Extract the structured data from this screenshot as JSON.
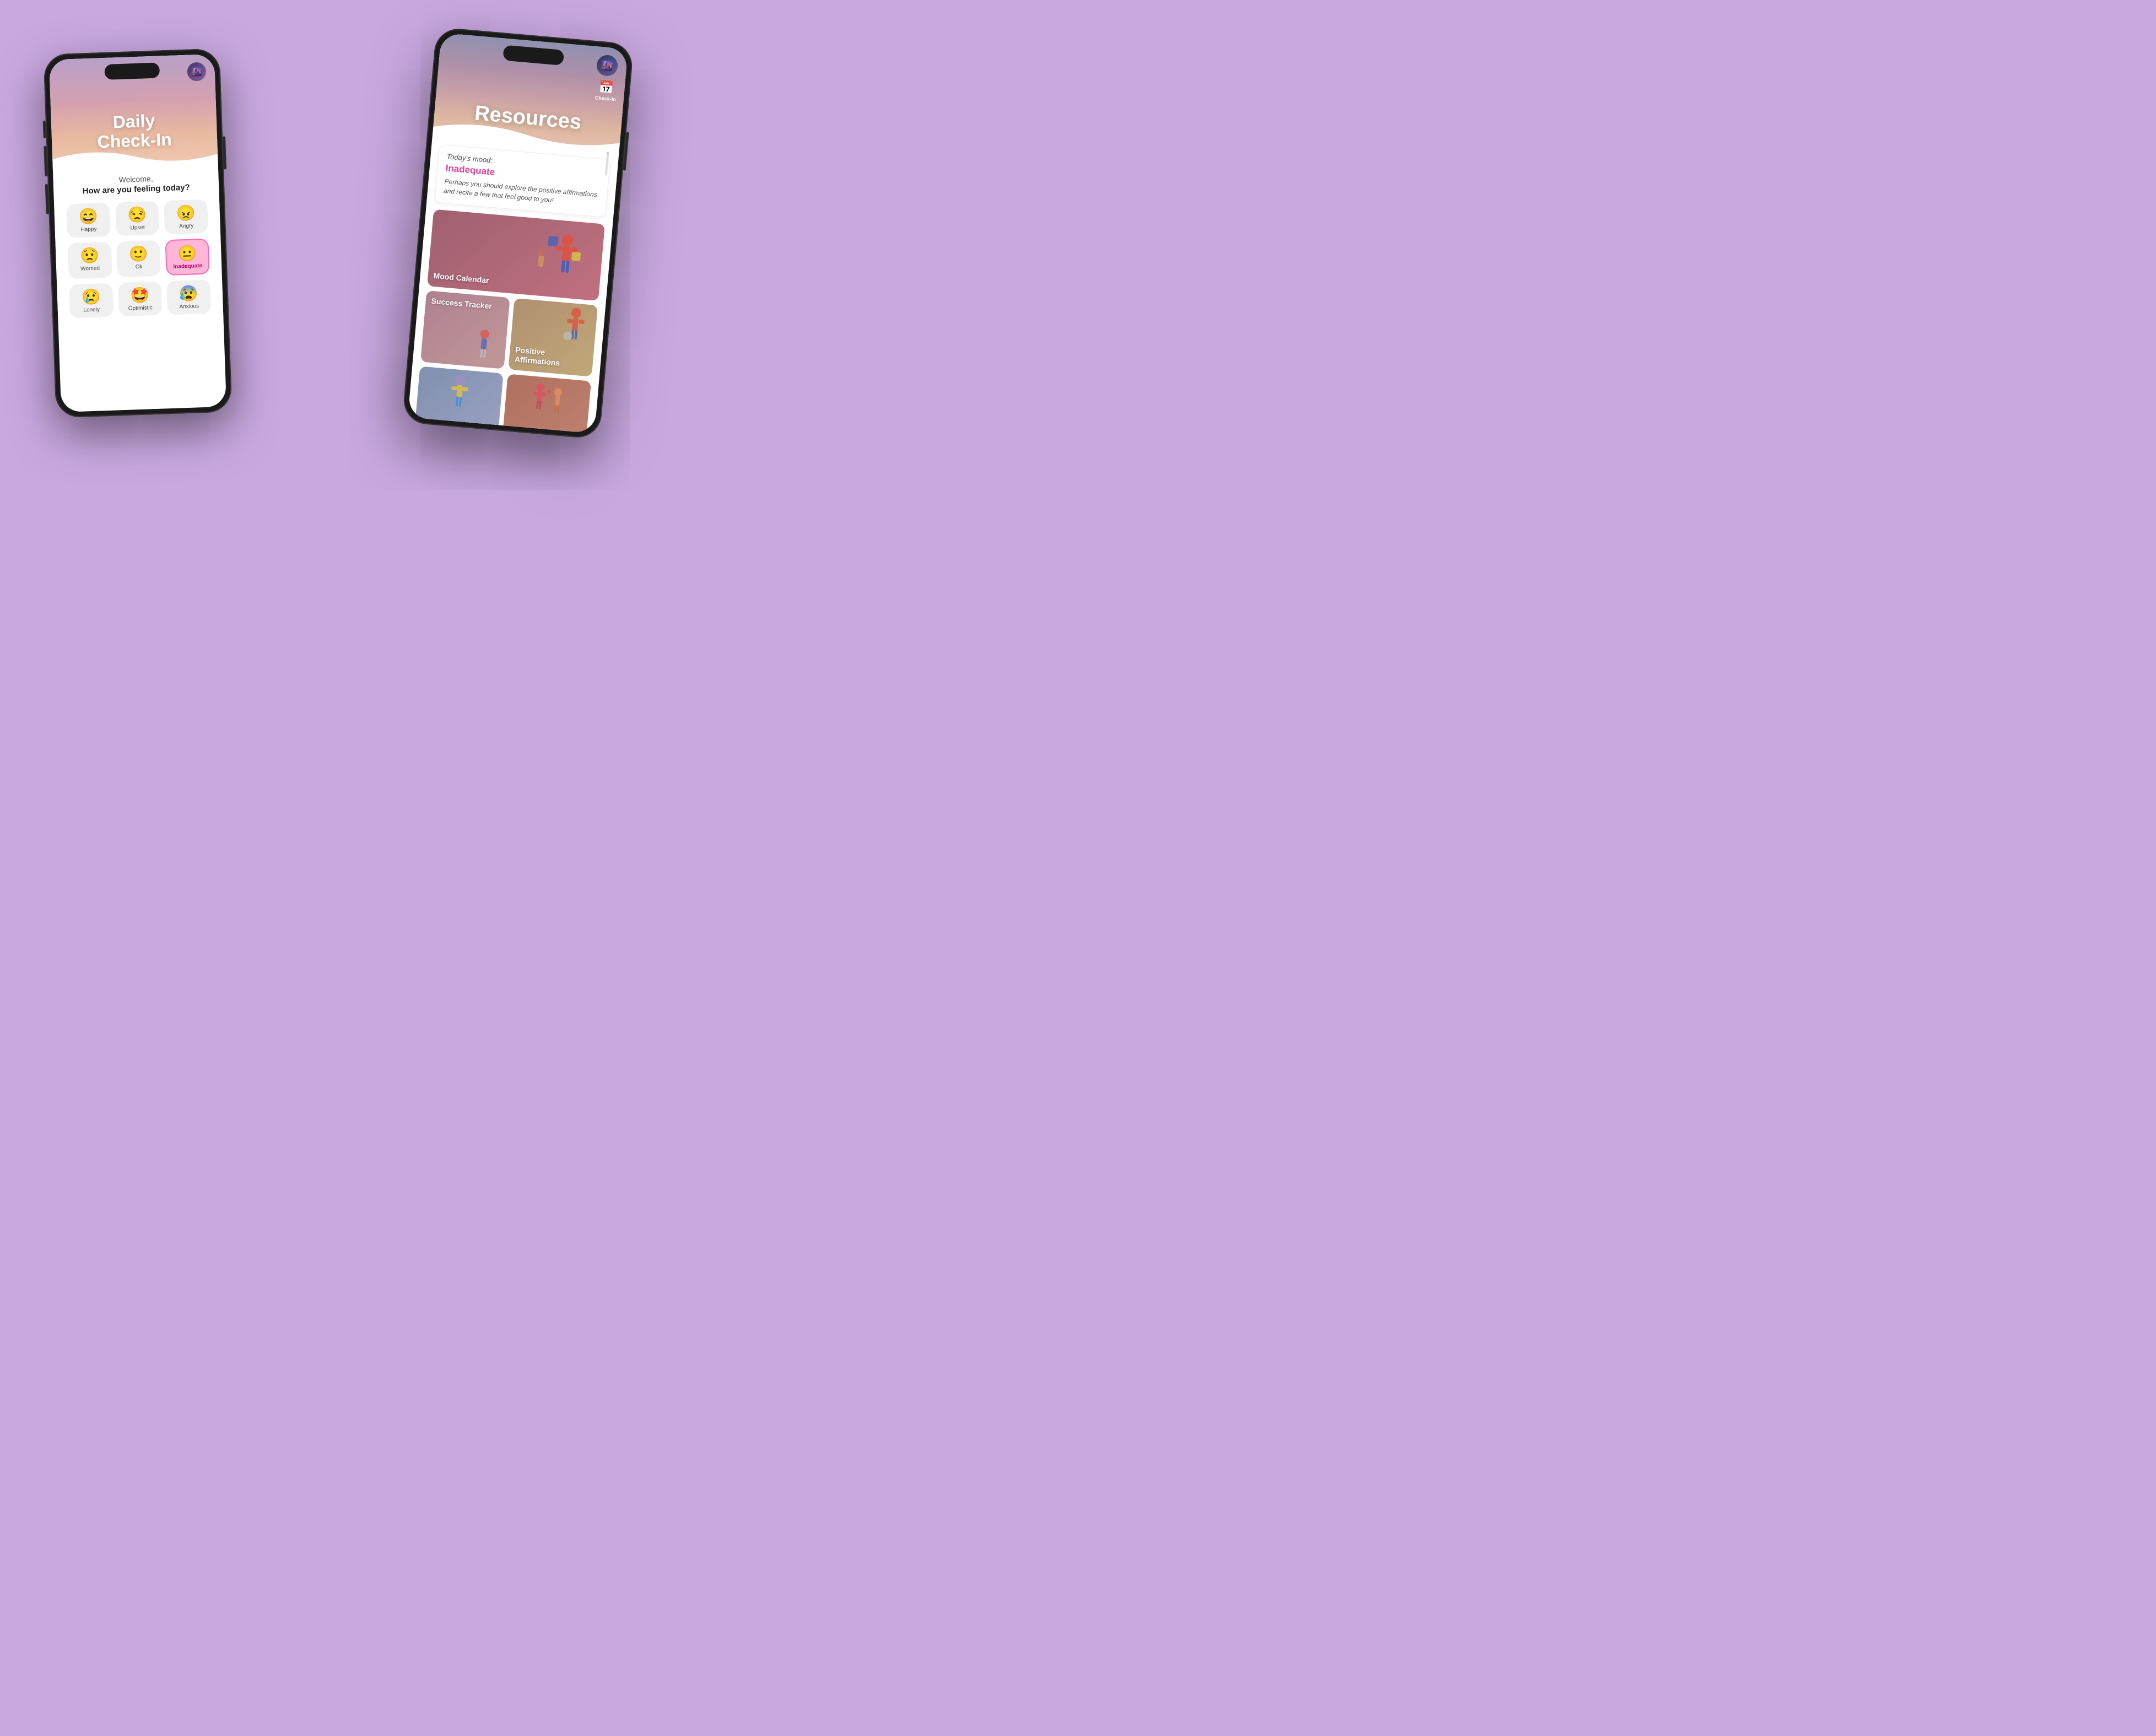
{
  "background_color": "#c9a8e0",
  "phone_left": {
    "title_line1": "Daily",
    "title_line2": "Check-In",
    "welcome": "Welcome,",
    "question": "How are you feeling today?",
    "emojis": [
      {
        "id": "happy",
        "emoji": "😄",
        "label": "Happy",
        "selected": false
      },
      {
        "id": "upset",
        "emoji": "😒",
        "label": "Upset",
        "selected": false
      },
      {
        "id": "angry",
        "emoji": "😠",
        "label": "Angry",
        "selected": false
      },
      {
        "id": "worried",
        "emoji": "😟",
        "label": "Worried",
        "selected": false
      },
      {
        "id": "ok",
        "emoji": "🙂",
        "label": "Ok",
        "selected": false
      },
      {
        "id": "inadequate",
        "emoji": "😐",
        "label": "Inadequate",
        "selected": true
      },
      {
        "id": "lonely",
        "emoji": "😢",
        "label": "Lonely",
        "selected": false
      },
      {
        "id": "optimistic",
        "emoji": "🤩",
        "label": "Optimistic",
        "selected": false
      },
      {
        "id": "anxious",
        "emoji": "😰",
        "label": "Anxious",
        "selected": false
      }
    ]
  },
  "phone_right": {
    "title": "Resources",
    "check_in_label": "Check-In",
    "mood_label": "Today's mood:",
    "mood_value": "Inadequate",
    "mood_description": "Perhaps you should explore the positive affirmations and recite a few that feel good to you!",
    "cards": [
      {
        "id": "mood-calendar",
        "label": "Mood Calendar",
        "size": "wide"
      },
      {
        "id": "success-tracker",
        "label": "Success Tracker",
        "size": "half"
      },
      {
        "id": "positive-affirmations",
        "label": "Positive Affirmations",
        "size": "half"
      },
      {
        "id": "card-bottom-left",
        "label": "",
        "size": "half"
      },
      {
        "id": "card-bottom-right",
        "label": "",
        "size": "half"
      }
    ]
  }
}
